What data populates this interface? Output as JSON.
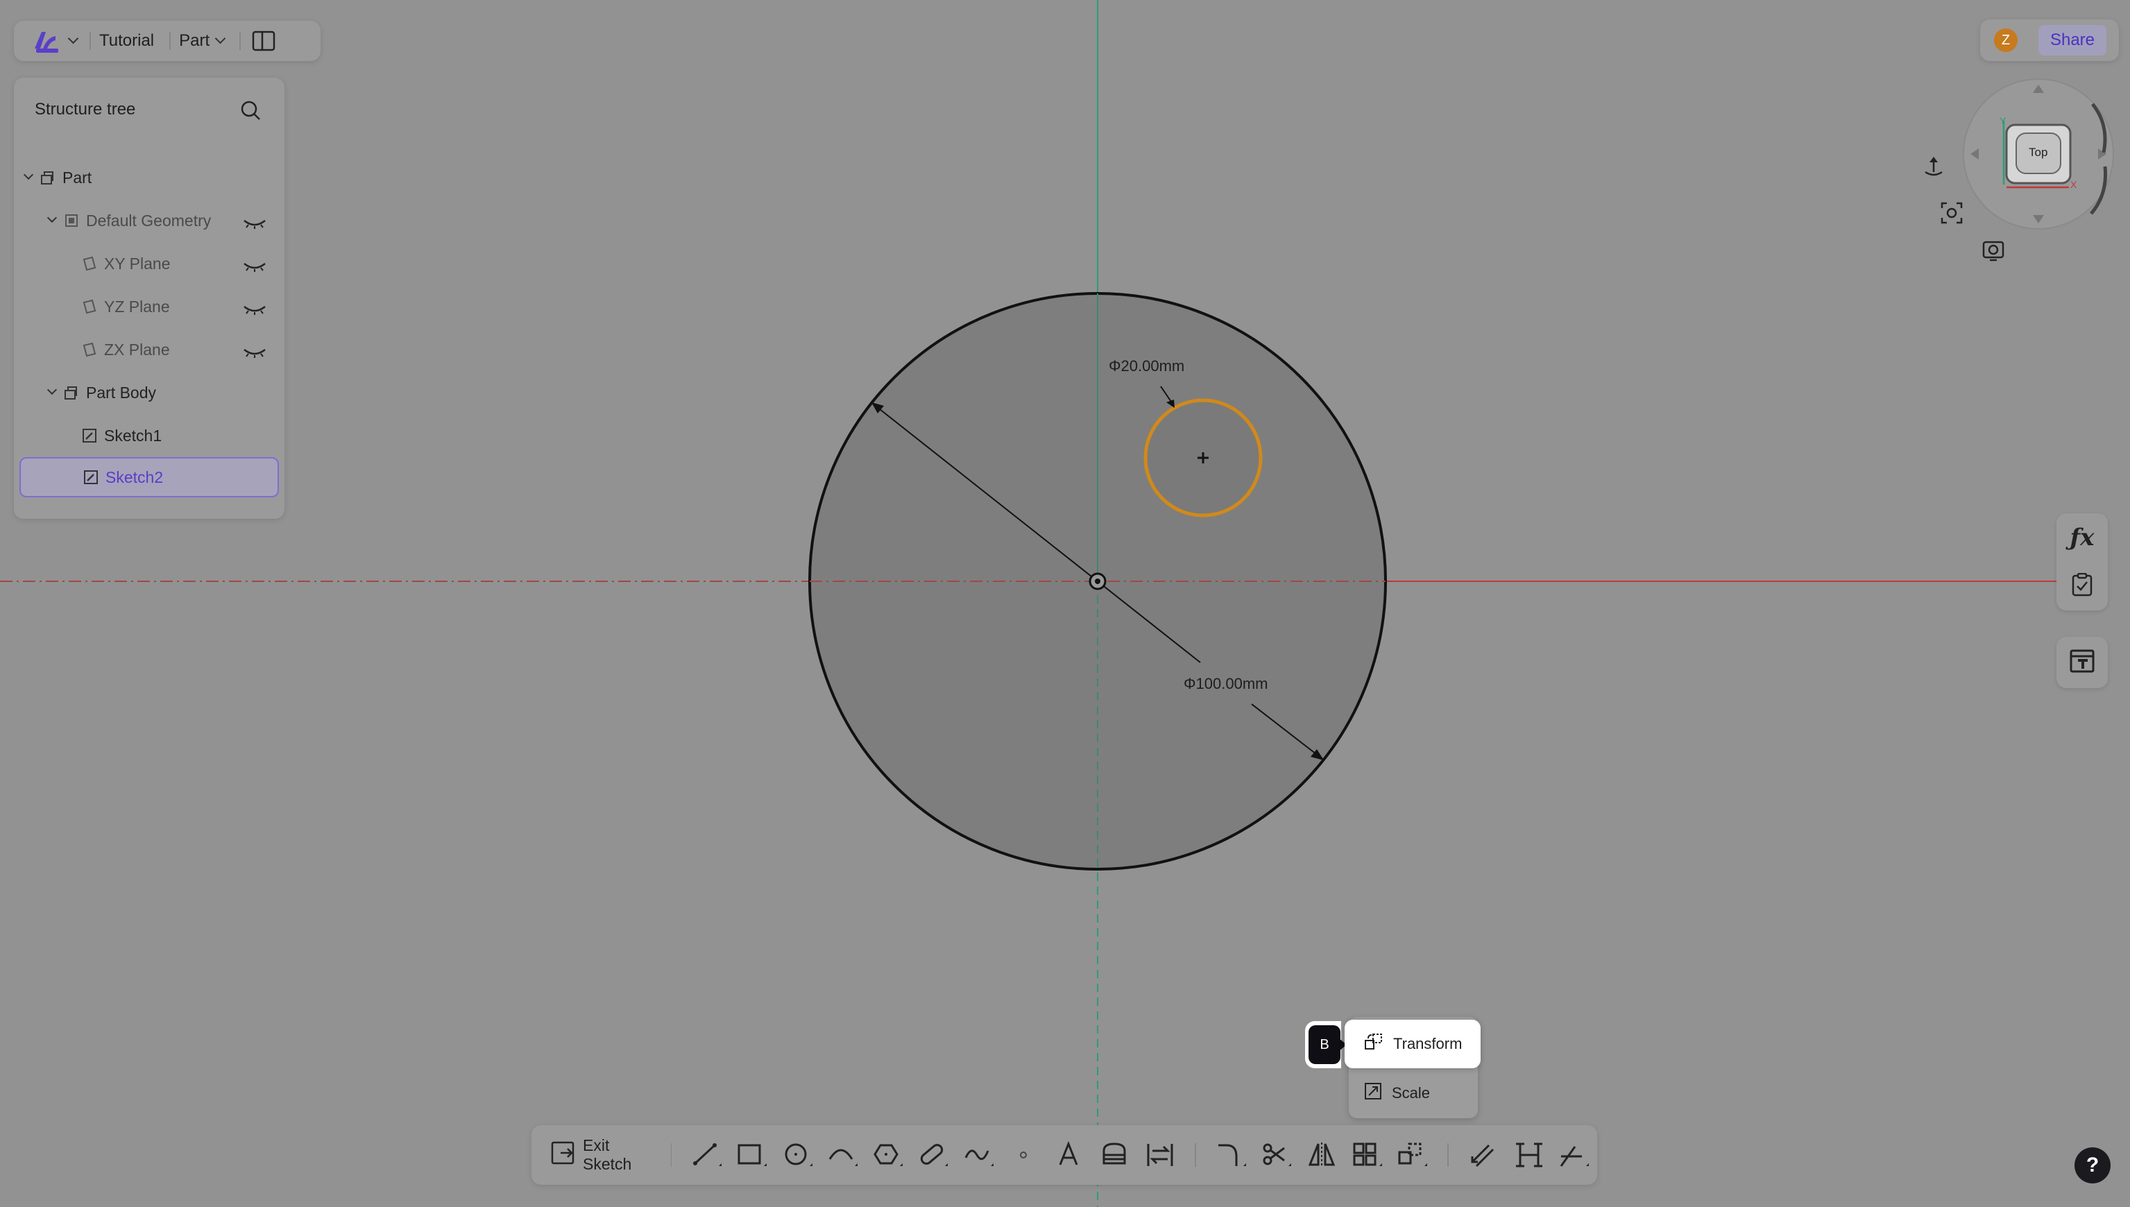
{
  "app": {
    "project_name": "Tutorial",
    "workspace_menu": "Part"
  },
  "share": {
    "avatar_initial": "Z",
    "share_label": "Share"
  },
  "tree": {
    "title": "Structure tree",
    "items": [
      {
        "label": "Part",
        "icon": "part-icon",
        "expanded": true,
        "visible_toggle": false
      },
      {
        "label": "Default Geometry",
        "icon": "geometry-group-icon",
        "expanded": true,
        "visible_toggle": true
      },
      {
        "label": "XY Plane",
        "icon": "plane-icon",
        "visible_toggle": true
      },
      {
        "label": "YZ Plane",
        "icon": "plane-icon",
        "visible_toggle": true
      },
      {
        "label": "ZX Plane",
        "icon": "plane-icon",
        "visible_toggle": true
      },
      {
        "label": "Part Body",
        "icon": "part-icon",
        "expanded": true,
        "visible_toggle": false
      },
      {
        "label": "Sketch1",
        "icon": "sketch-icon",
        "visible_toggle": false
      },
      {
        "label": "Sketch2",
        "icon": "sketch-icon",
        "selected": true,
        "visible_toggle": false
      }
    ]
  },
  "view_cube": {
    "face_label": "Top",
    "axis_y": "Y",
    "axis_x": "X"
  },
  "canvas": {
    "dim_small": "Φ20.00mm",
    "dim_large": "Φ100.00mm",
    "colors": {
      "x_axis": "#c0393b",
      "y_axis": "#2e9d74",
      "selected_circle": "#d08a1a",
      "sketch_face": "#7e7e7e"
    }
  },
  "toolbar": {
    "exit_label": "Exit Sketch",
    "tools": [
      "line-tool-icon",
      "rectangle-tool-icon",
      "circle-tool-icon",
      "arc-tool-icon",
      "polygon-tool-icon",
      "slot-tool-icon",
      "spline-tool-icon",
      "point-tool-icon",
      "text-tool-icon",
      "project-tool-icon",
      "convert-tool-icon",
      "fillet-tool-icon",
      "trim-tool-icon",
      "mirror-tool-icon",
      "pattern-tool-icon",
      "transform-tool-icon",
      "offset-tool-icon",
      "dimension-tool-icon",
      "constraint-tool-icon"
    ]
  },
  "context_menu": {
    "shortcut": "B",
    "items": [
      {
        "label": "Transform",
        "highlighted": true
      },
      {
        "label": "Scale",
        "highlighted": false
      }
    ]
  },
  "help_label": "?"
}
